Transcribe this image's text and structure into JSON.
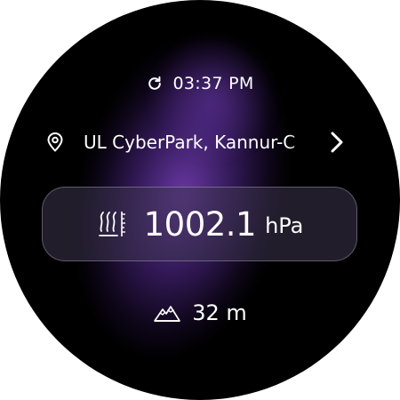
{
  "header": {
    "refresh_icon": "refresh-icon",
    "time": "03:37 PM"
  },
  "location": {
    "pin_icon": "location-pin-icon",
    "name": "UL CyberPark, Kannur-C",
    "chevron_icon": "chevron-right-icon"
  },
  "pressure": {
    "icon": "barometer-gauge-icon",
    "value": "1002.1",
    "unit": "hPa"
  },
  "altitude": {
    "icon": "mountain-icon",
    "value": "32 m"
  },
  "colors": {
    "background": "#000000",
    "glow": "#8a4fe0",
    "text": "#ffffff",
    "card_border": "#6a6478"
  }
}
